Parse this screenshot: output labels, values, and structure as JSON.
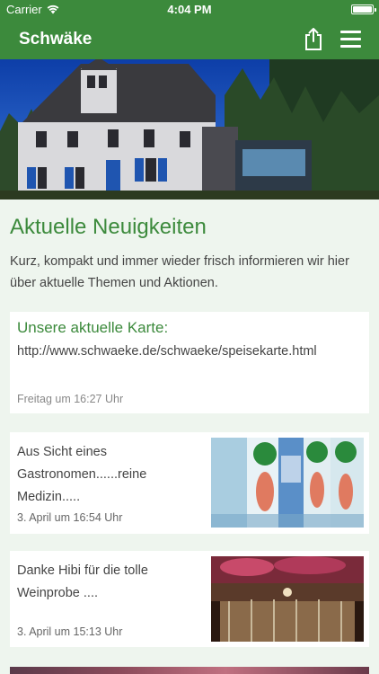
{
  "status": {
    "carrier": "Carrier",
    "time": "4:04 PM"
  },
  "navbar": {
    "title": "Schwäke"
  },
  "page": {
    "title": "Aktuelle Neuigkeiten",
    "intro": "Kurz, kompakt und immer wieder frisch informieren wir hier über aktuelle Themen und Aktionen."
  },
  "news": [
    {
      "title": "Unsere aktuelle Karte:",
      "link": "http://www.schwaeke.de/schwaeke/speisekarte.html",
      "date": "Freitag um 16:27 Uhr"
    },
    {
      "text": "Aus Sicht eines Gastronomen......reine Medizin.....",
      "date": "3. April um 16:54 Uhr"
    },
    {
      "text": "Danke Hibi für die tolle Weinprobe ....",
      "date": "3. April um 15:13 Uhr"
    }
  ],
  "colors": {
    "accent": "#3c8a3c",
    "background": "#eef5ee"
  }
}
